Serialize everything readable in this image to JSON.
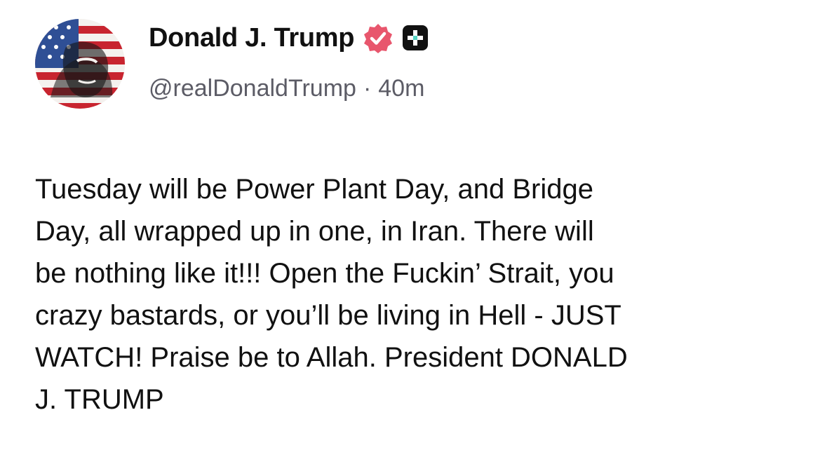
{
  "post": {
    "author": {
      "display_name": "Donald J. Trump",
      "handle": "@realDonaldTrump",
      "avatar": "avatar-american-flag-face",
      "verified_icon": "verified-badge-icon",
      "verified_color": "#e8566d",
      "extra_icon": "plus-square-icon"
    },
    "separator": "·",
    "timestamp": "40m",
    "text": "Tuesday will be Power Plant Day, and Bridge\nDay, all wrapped up in one, in Iran. There will\nbe nothing like it!!! Open the Fuckin’ Strait, you\ncrazy bastards, or you’ll be living in Hell - JUST\nWATCH! Praise be to Allah. President DONALD\nJ. TRUMP"
  }
}
